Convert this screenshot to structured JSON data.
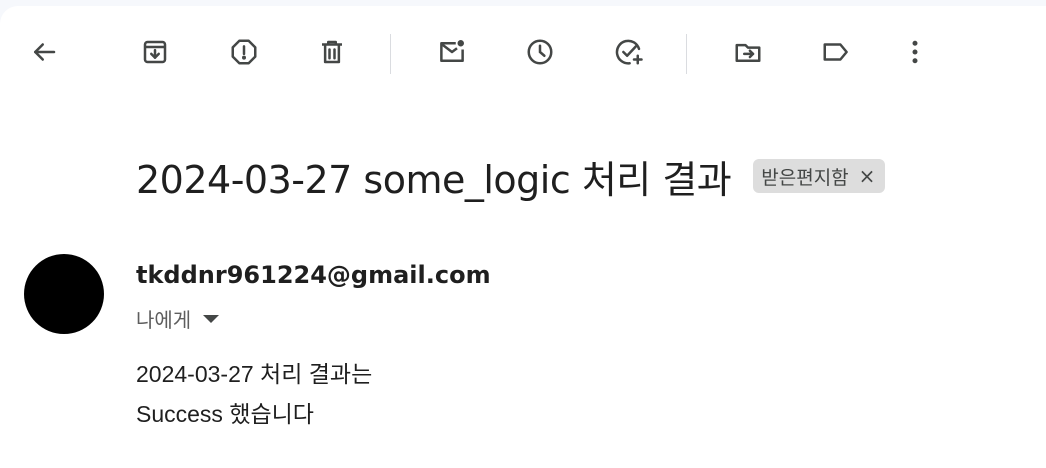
{
  "toolbar": {
    "buttons": [
      {
        "name": "back-button",
        "icon": "arrow-left-icon"
      },
      {
        "name": "archive-button",
        "icon": "archive-icon"
      },
      {
        "name": "report-spam-button",
        "icon": "report-spam-icon"
      },
      {
        "name": "delete-button",
        "icon": "trash-icon"
      },
      {
        "name": "mark-unread-button",
        "icon": "mark-unread-icon"
      },
      {
        "name": "snooze-button",
        "icon": "clock-icon"
      },
      {
        "name": "add-to-tasks-button",
        "icon": "add-task-icon"
      },
      {
        "name": "move-to-button",
        "icon": "move-to-folder-icon"
      },
      {
        "name": "labels-button",
        "icon": "label-icon"
      },
      {
        "name": "more-button",
        "icon": "more-vert-icon"
      }
    ],
    "icon_color": "#444746"
  },
  "email": {
    "subject": "2024-03-27 some_logic 처리 결과",
    "label": "받은편지함",
    "label_remove": "×",
    "sender": "tkddnr961224@gmail.com",
    "recipient": "나에게",
    "body_lines": [
      "2024-03-27 처리 결과는",
      "Success 했습니다"
    ]
  }
}
